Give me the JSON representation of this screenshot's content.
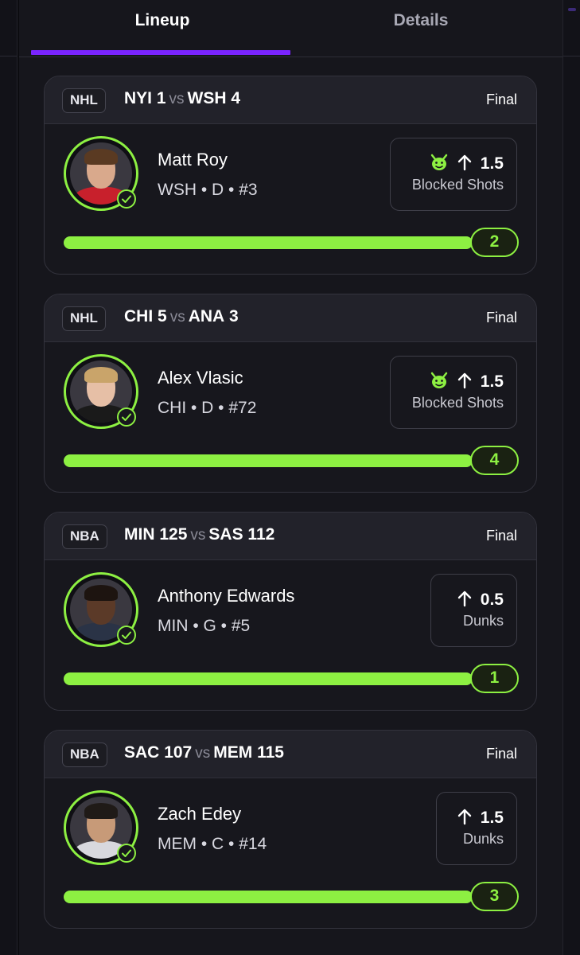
{
  "tabs": [
    {
      "label": "Lineup",
      "active": true
    },
    {
      "label": "Details",
      "active": false
    }
  ],
  "colors": {
    "accent": "#7a24ff",
    "progress": "#8df042",
    "card_bg": "#17171d",
    "header_bg": "#22222a"
  },
  "picks": [
    {
      "league": "NHL",
      "away_team": "NYI",
      "away_score": "1",
      "vs": "vs",
      "home_team": "WSH",
      "home_score": "4",
      "status": "Final",
      "player_name": "Matt Roy",
      "player_meta": "WSH • D • #3",
      "has_demon_icon": true,
      "direction_icon": "arrow-up-icon",
      "line": "1.5",
      "stat": "Blocked Shots",
      "progress_percent": 100,
      "result": "2"
    },
    {
      "league": "NHL",
      "away_team": "CHI",
      "away_score": "5",
      "vs": "vs",
      "home_team": "ANA",
      "home_score": "3",
      "status": "Final",
      "player_name": "Alex Vlasic",
      "player_meta": "CHI • D • #72",
      "has_demon_icon": true,
      "direction_icon": "arrow-up-icon",
      "line": "1.5",
      "stat": "Blocked Shots",
      "progress_percent": 100,
      "result": "4"
    },
    {
      "league": "NBA",
      "away_team": "MIN",
      "away_score": "125",
      "vs": "vs",
      "home_team": "SAS",
      "home_score": "112",
      "status": "Final",
      "player_name": "Anthony Edwards",
      "player_meta": "MIN • G • #5",
      "has_demon_icon": false,
      "direction_icon": "arrow-up-icon",
      "line": "0.5",
      "stat": "Dunks",
      "progress_percent": 100,
      "result": "1"
    },
    {
      "league": "NBA",
      "away_team": "SAC",
      "away_score": "107",
      "vs": "vs",
      "home_team": "MEM",
      "home_score": "115",
      "status": "Final",
      "player_name": "Zach Edey",
      "player_meta": "MEM • C • #14",
      "has_demon_icon": false,
      "direction_icon": "arrow-up-icon",
      "line": "1.5",
      "stat": "Dunks",
      "progress_percent": 100,
      "result": "3"
    }
  ]
}
